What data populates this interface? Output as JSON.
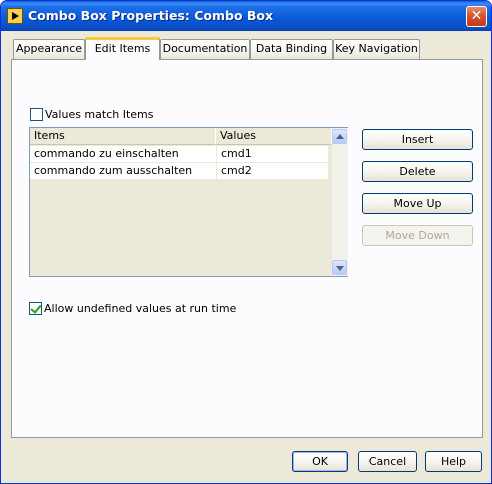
{
  "window": {
    "title": "Combo Box Properties: Combo Box",
    "close_glyph": "✕"
  },
  "tabs": [
    {
      "label": "Appearance"
    },
    {
      "label": "Edit Items"
    },
    {
      "label": "Documentation"
    },
    {
      "label": "Data Binding"
    },
    {
      "label": "Key Navigation"
    }
  ],
  "active_tab": "Edit Items",
  "values_match": {
    "label": "Values match Items",
    "checked": false
  },
  "table": {
    "headers": [
      "Items",
      "Values"
    ],
    "rows": [
      {
        "item": "commando zu einschalten",
        "value": "cmd1"
      },
      {
        "item": "commando zum ausschalten",
        "value": "cmd2"
      }
    ]
  },
  "side_buttons": {
    "insert": "Insert",
    "delete": "Delete",
    "move_up": "Move Up",
    "move_down": "Move Down"
  },
  "allow_undefined": {
    "label": "Allow undefined values at run time",
    "checked": true
  },
  "footer": {
    "ok": "OK",
    "cancel": "Cancel",
    "help": "Help"
  },
  "colors": {
    "titlebar": "#0a5fd8",
    "dialog_bg": "#ece9d8",
    "tab_highlight": "#ffc83c",
    "check": "#21a121"
  },
  "icons": [
    "labview-app-icon",
    "close-icon",
    "scroll-up-icon",
    "scroll-down-icon",
    "checkmark-icon"
  ]
}
